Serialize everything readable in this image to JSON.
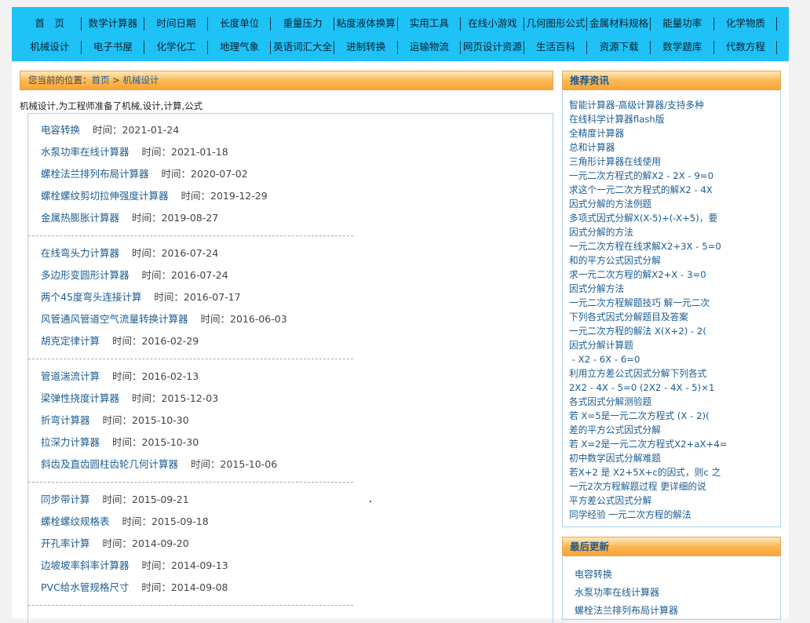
{
  "nav": {
    "row1": [
      "首　页",
      "数学计算器",
      "时间日期",
      "长度单位",
      "重量压力",
      "粘度液体换算",
      "实用工具",
      "在线小游戏",
      "几何图形公式",
      "金属材料规格",
      "能量功率",
      "化学物质"
    ],
    "row2": [
      "机械设计",
      "电子书屋",
      "化学化工",
      "地理气象",
      "英语词汇大全",
      "进制转换",
      "运输物流",
      "网页设计资源",
      "生活百科",
      "资源下载",
      "数学题库",
      "代数方程"
    ]
  },
  "breadcrumb": {
    "prefix": "您当前的位置：",
    "home": "首页",
    "sep": " > ",
    "current": "机械设计"
  },
  "intro": "机械设计,为工程师准备了机械,设计,计算,公式",
  "time_label": "时间：",
  "groups": [
    [
      {
        "title": "电容转换",
        "date": "2021-01-24"
      },
      {
        "title": "水泵功率在线计算器",
        "date": "2021-01-18"
      },
      {
        "title": "螺栓法兰排列布局计算器",
        "date": "2020-07-02"
      },
      {
        "title": "螺栓螺纹剪切拉伸强度计算器",
        "date": "2019-12-29"
      },
      {
        "title": "金属热膨胀计算器",
        "date": "2019-08-27"
      }
    ],
    [
      {
        "title": "在线弯头力计算器",
        "date": "2016-07-24"
      },
      {
        "title": "多边形变圆形计算器",
        "date": "2016-07-24"
      },
      {
        "title": "两个45度弯头连接计算",
        "date": "2016-07-17"
      },
      {
        "title": "风管通风管道空气流量转换计算器",
        "date": "2016-06-03"
      },
      {
        "title": "胡克定律计算",
        "date": "2016-02-29"
      }
    ],
    [
      {
        "title": "管道湍流计算",
        "date": "2016-02-13"
      },
      {
        "title": "梁弹性挠度计算器",
        "date": "2015-12-03"
      },
      {
        "title": "折弯计算器",
        "date": "2015-10-30"
      },
      {
        "title": "拉深力计算器",
        "date": "2015-10-30"
      },
      {
        "title": "斜齿及直齿圆柱齿轮几何计算器",
        "date": "2015-10-06"
      }
    ],
    [
      {
        "title": "同步带计算",
        "date": "2015-09-21"
      },
      {
        "title": "螺栓螺纹规格表",
        "date": "2015-09-18"
      },
      {
        "title": "开孔率计算",
        "date": "2014-09-20"
      },
      {
        "title": "边坡坡率斜率计算器",
        "date": "2014-09-13"
      },
      {
        "title": "PVC给水管规格尺寸",
        "date": "2014-09-08"
      }
    ]
  ],
  "recommend": {
    "title": "推荐资讯",
    "items": [
      "智能计算器-高级计算器/支持多种",
      "在线科学计算器flash版",
      "全精度计算器",
      "总和计算器",
      "三角形计算器在线使用",
      "一元二次方程式的解X2 - 2X - 9=0",
      "求这个一元二次方程式的解X2 - 4X",
      "因式分解的方法例题",
      "多项式因式分解X(X-5)+(-X+5)，要",
      "因式分解的方法",
      "一元二次方程在线求解X2+3X - 5=0",
      "和的平方公式因式分解",
      "求一元二次方程的解X2+X - 3=0",
      "因式分解方法",
      "一元二次方程解题技巧 解一元二次",
      "下列各式因式分解题目及答案",
      "一元二次方程的解法 X(X+2) - 2(",
      "因式分解计算题",
      " - X2 - 6X - 6=0",
      "利用立方差公式因式分解下列各式",
      "2X2 - 4X - 5=0 (2X2 - 4X - 5)×1",
      "各式因式分解测验题",
      "若 X=5是一元二次方程式 (X - 2)(",
      "差的平方公式因式分解",
      "若 X=2是一元二次方程式X2+aX+4=",
      "初中数学因式分解难题",
      "若X+2 是 X2+5X+c的因式，则c 之",
      "一元2次方程解题过程 更详细的说",
      "平方差公式因式分解",
      "同学经验 一元二次方程的解法"
    ]
  },
  "updates": {
    "title": "最后更新",
    "items": [
      "电容转换",
      "水泵功率在线计算器",
      "螺栓法兰排列布局计算器"
    ]
  }
}
